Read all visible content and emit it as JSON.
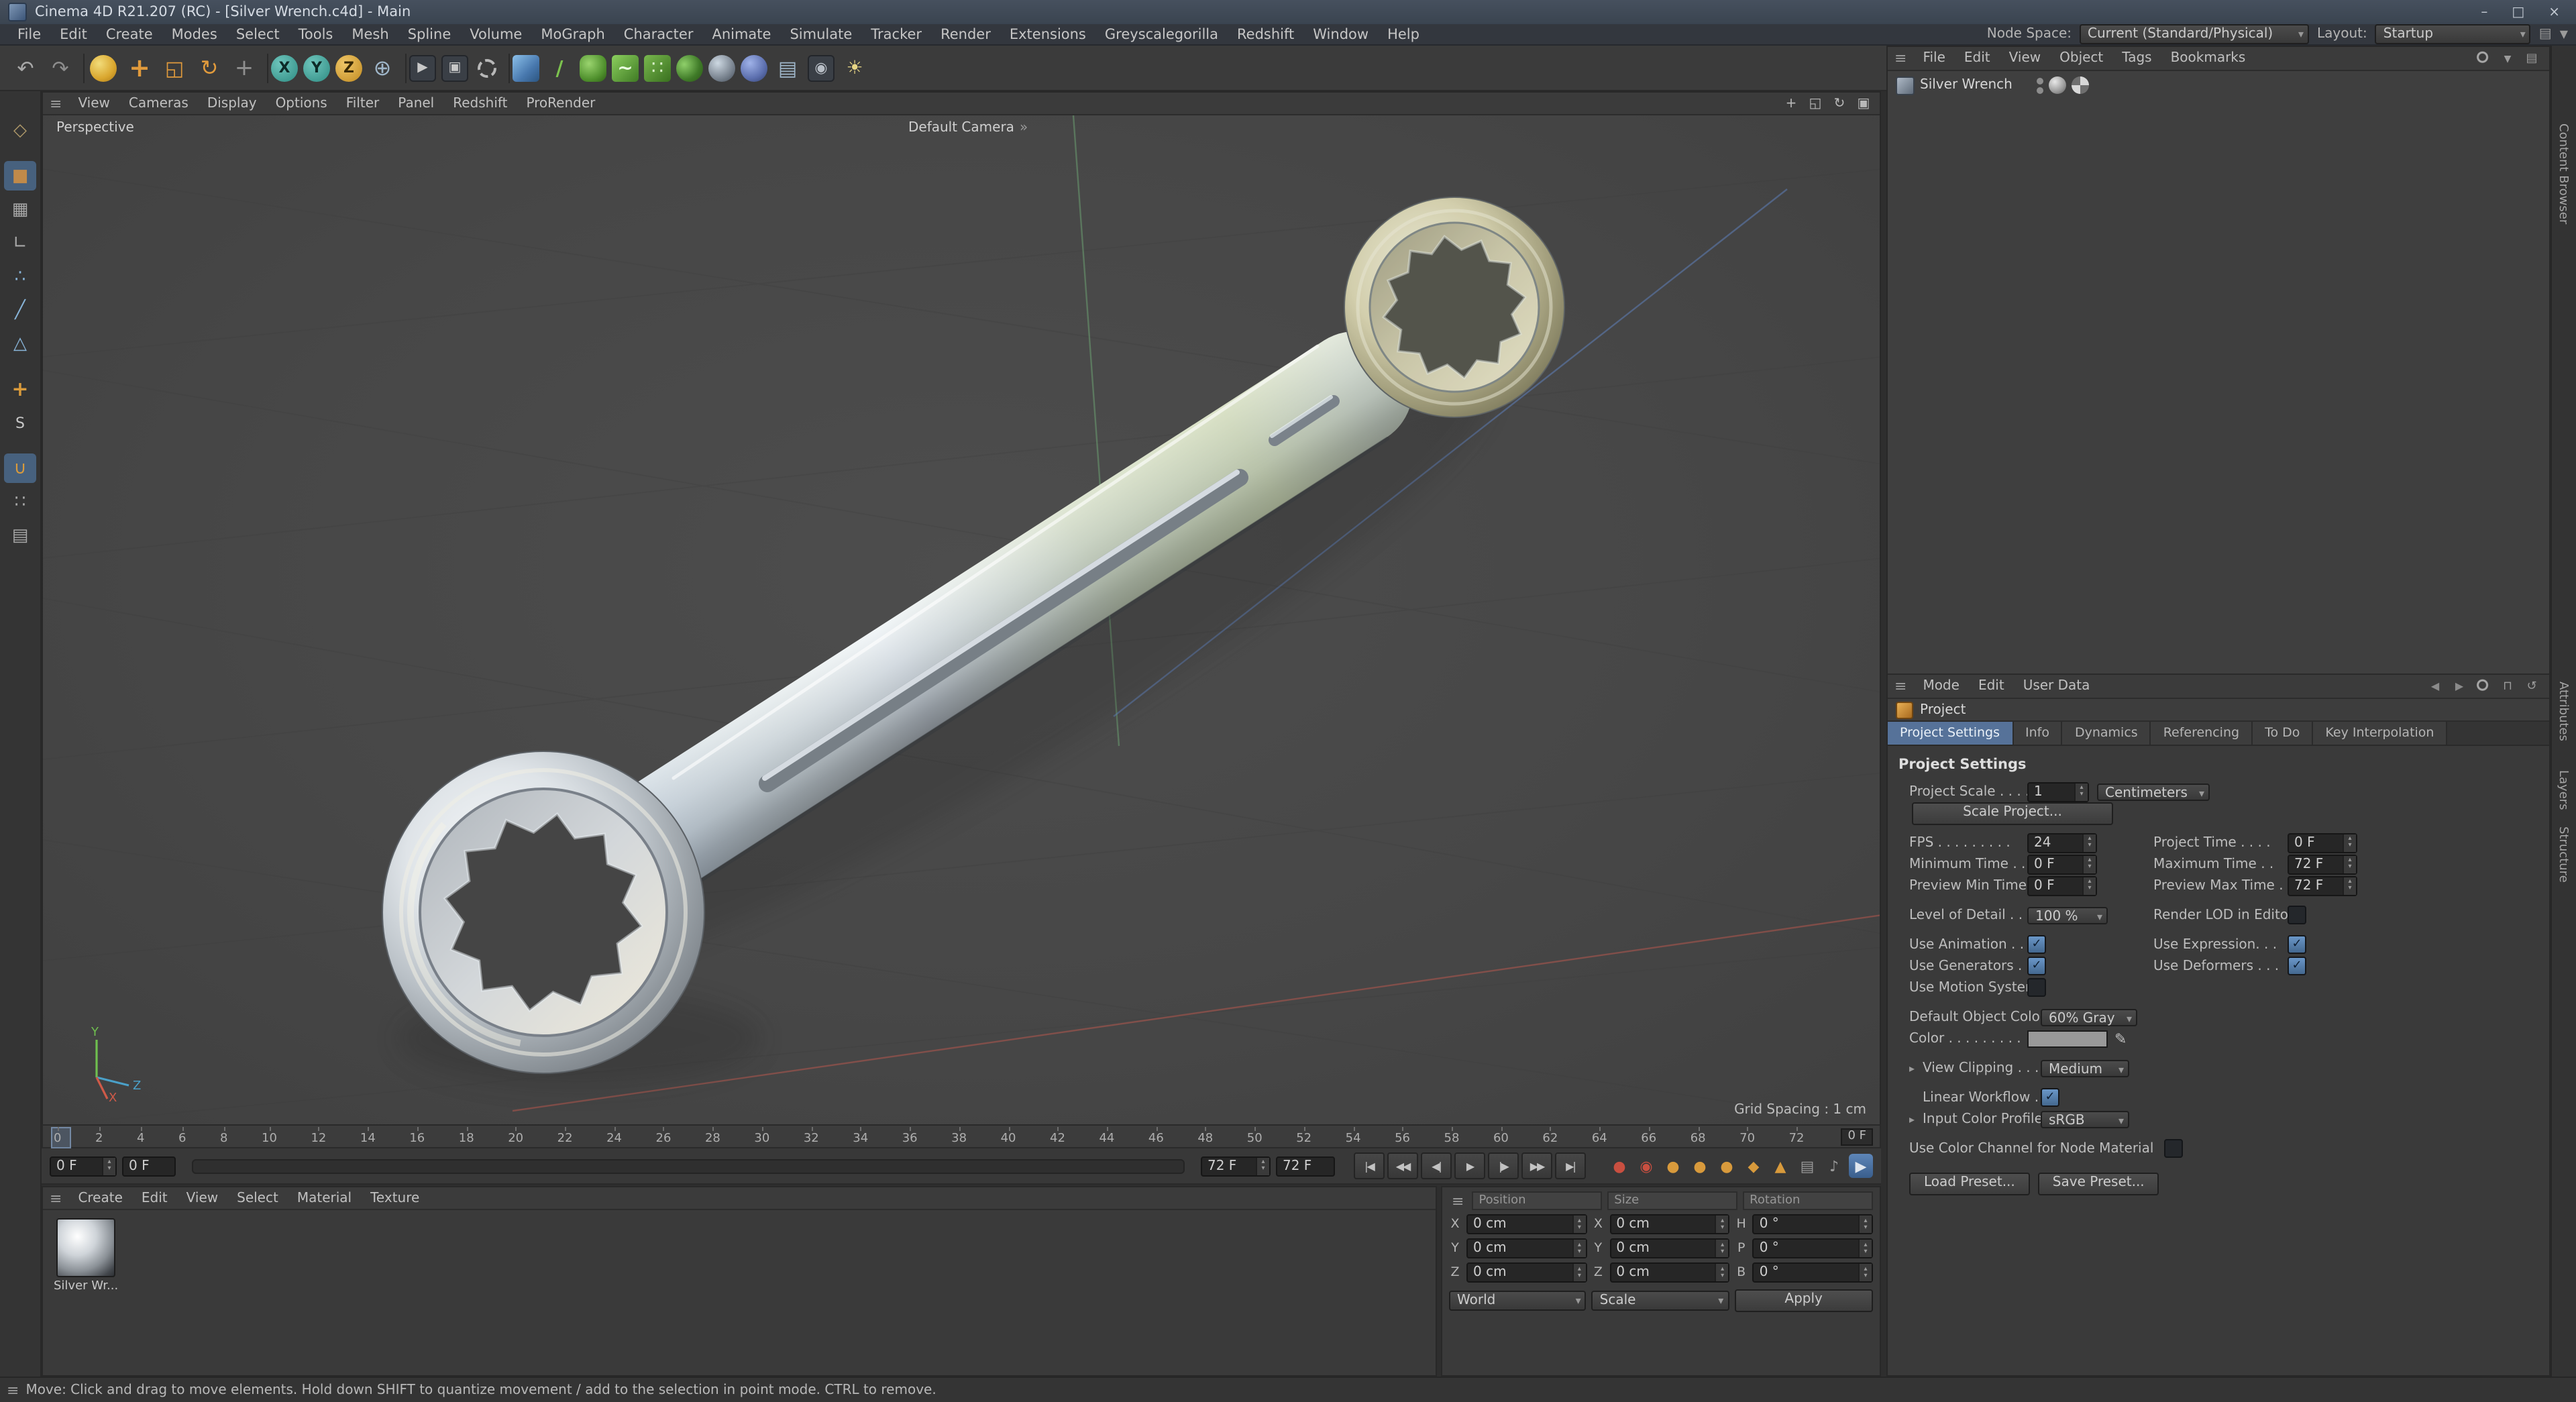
{
  "window": {
    "title": "Cinema 4D R21.207 (RC) - [Silver Wrench.c4d] - Main",
    "minimize": "–",
    "restore": "□",
    "close": "×"
  },
  "menu_bar": {
    "items": [
      "File",
      "Edit",
      "Create",
      "Modes",
      "Select",
      "Tools",
      "Mesh",
      "Spline",
      "Volume",
      "MoGraph",
      "Character",
      "Animate",
      "Simulate",
      "Tracker",
      "Render",
      "Extensions",
      "Greyscalegorilla",
      "Redshift",
      "Window",
      "Help"
    ],
    "node_space_label": "Node Space:",
    "node_space_value": "Current (Standard/Physical)",
    "layout_label": "Layout:",
    "layout_value": "Startup"
  },
  "toolbar": {
    "items": [
      {
        "name": "undo-icon",
        "glyph": "↶",
        "style": "color:#a8a8a8;font-size:15px",
        "inter": "true"
      },
      {
        "name": "redo-icon",
        "glyph": "↷",
        "style": "color:#8d8d8d;font-size:15px",
        "inter": "true"
      },
      {
        "name": "toolbar-separator",
        "glyph": "",
        "style": "width:5px;height:22px;border-right:1px solid #2a2a2a",
        "inter": "false"
      },
      {
        "name": "live-selection-icon",
        "glyph": "",
        "style": "background:radial-gradient(circle at 35% 32%,#f2dc7a,#d9a62e 60%,#a87818);border-radius:50%;width:20px;height:20px;margin:3px 4px",
        "inter": "true"
      },
      {
        "name": "move-tool-icon",
        "glyph": "+",
        "style": "color:#e09a3c;font-size:19px;font-weight:bold",
        "inter": "true"
      },
      {
        "name": "scale-tool-icon",
        "glyph": "◱",
        "style": "color:#e09a3c;font-size:15px",
        "inter": "true"
      },
      {
        "name": "rotate-tool-icon",
        "glyph": "↻",
        "style": "color:#e09a3c;font-size:16px",
        "inter": "true"
      },
      {
        "name": "last-tool-icon",
        "glyph": "+",
        "style": "color:#8f8f8f;font-size:17px",
        "inter": "true"
      },
      {
        "name": "toolbar-separator",
        "glyph": "",
        "style": "width:5px;height:22px;border-right:1px solid #2a2a2a",
        "inter": "false"
      },
      {
        "name": "x-axis-lock-button",
        "glyph": "X",
        "style": "background:radial-gradient(circle at 35% 32%,#6fc6bd,#2e8b82);border-radius:50%;color:#0d2b28;font-weight:bold;width:20px;height:20px;margin:3px 2px;font-size:11px",
        "inter": "true"
      },
      {
        "name": "y-axis-lock-button",
        "glyph": "Y",
        "style": "background:radial-gradient(circle at 35% 32%,#6fc6bd,#2e8b82);border-radius:50%;color:#0d2b28;font-weight:bold;width:20px;height:20px;margin:3px 2px;font-size:11px",
        "inter": "true"
      },
      {
        "name": "z-axis-lock-button",
        "glyph": "Z",
        "style": "background:radial-gradient(circle at 35% 32%,#f0c768,#c08a20);border-radius:50%;color:#3a2a05;font-weight:bold;width:20px;height:20px;margin:3px 2px;font-size:11px",
        "inter": "true"
      },
      {
        "name": "coordinate-system-icon",
        "glyph": "⊕",
        "style": "color:#9fb6c9;font-size:16px",
        "inter": "true"
      },
      {
        "name": "toolbar-separator",
        "glyph": "",
        "style": "width:5px;height:22px;border-right:1px solid #2a2a2a",
        "inter": "false"
      },
      {
        "name": "render-view-icon",
        "glyph": "▶",
        "style": "color:#c8c8c8;background:#3a3f46;border:1px solid #23262b;border-radius:3px;width:20px;height:20px;margin:3px 2px;font-size:10px",
        "inter": "true"
      },
      {
        "name": "render-to-picture-viewer-icon",
        "glyph": "▣",
        "style": "color:#c8c8c8;background:#3a3f46;border:1px solid #23262b;border-radius:3px;width:20px;height:20px;margin:3px 2px;font-size:10px",
        "inter": "true"
      },
      {
        "name": "render-settings-icon",
        "glyph": "",
        "style": "width:14px;height:14px;border:2px dashed #b8b8b8;border-radius:50%;margin:5px 5px",
        "inter": "true"
      },
      {
        "name": "toolbar-separator",
        "glyph": "",
        "style": "width:5px;height:22px;border-right:1px solid #2a2a2a",
        "inter": "false"
      },
      {
        "name": "add-cube-icon",
        "glyph": "",
        "style": "background:linear-gradient(135deg,#8cc1ea,#4878ae 60%,#2c5580);border-radius:3px;width:20px;height:20px;margin:3px 2px",
        "inter": "true"
      },
      {
        "name": "pen-spline-icon",
        "glyph": "/",
        "style": "color:#7cc24e;font-weight:bold;font-size:15px",
        "inter": "true"
      },
      {
        "name": "subdivision-surface-icon",
        "glyph": "",
        "style": "background:radial-gradient(circle at 35% 32%,#9ad46e,#4e8f2c 65%,#2f5c18);border-radius:6px;width:20px;height:20px;margin:3px 2px",
        "inter": "true"
      },
      {
        "name": "bend-deformer-icon",
        "glyph": "~",
        "style": "color:#eaffe0;background:linear-gradient(135deg,#8cd05e,#3f7a24);border-radius:3px;width:20px;height:20px;margin:3px 2px;font-weight:bold",
        "inter": "true"
      },
      {
        "name": "array-generator-icon",
        "glyph": "∷",
        "style": "color:#d8f0c8;background:linear-gradient(135deg,#79b84e,#39701f);border-radius:3px;width:20px;height:20px;margin:3px 2px",
        "inter": "true"
      },
      {
        "name": "boole-icon",
        "glyph": "",
        "style": "background:radial-gradient(circle at 30% 35%,#8fd06a,#3f7a28 60%,#2a5416);border-radius:50%;width:20px;height:20px;margin:3px 2px",
        "inter": "true"
      },
      {
        "name": "metaball-icon",
        "glyph": "",
        "style": "background:radial-gradient(circle at 35% 30%,#cdd8e2,#6c7682 70%,#3e444c);border-radius:50%;width:20px;height:20px;margin:3px 2px",
        "inter": "true"
      },
      {
        "name": "environment-icon",
        "glyph": "",
        "style": "background:radial-gradient(circle at 35% 30%,#9fb2e8,#5c6fae 60%,#32406e);border-radius:50%;width:20px;height:20px;margin:3px 2px",
        "inter": "true"
      },
      {
        "name": "floor-grid-icon",
        "glyph": "▤",
        "style": "color:#9fb6c9;font-size:15px",
        "inter": "true"
      },
      {
        "name": "camera-icon",
        "glyph": "◉",
        "style": "color:#b8bec6;background:#3a3f46;border:1px solid #23262b;border-radius:3px;width:20px;height:20px;margin:3px 2px;font-size:11px",
        "inter": "true"
      },
      {
        "name": "light-icon",
        "glyph": "☀",
        "style": "color:#e8d684;font-size:14px",
        "inter": "true"
      }
    ]
  },
  "left_toolbar": {
    "items": [
      {
        "name": "make-editable-icon",
        "glyph": "◇",
        "style": "color:#b09a6a",
        "inter": "true"
      },
      {
        "name": "left-separator",
        "glyph": "",
        "style": "height:6px",
        "inter": "false"
      },
      {
        "name": "use-model-mode-icon",
        "glyph": "■",
        "style": "color:#c08a4a;background:#47617e;border-radius:3px",
        "inter": "true"
      },
      {
        "name": "use-texture-mode-icon",
        "glyph": "▦",
        "style": "color:#a8a8a8",
        "inter": "true"
      },
      {
        "name": "workplane-mode-icon",
        "glyph": "∟",
        "style": "color:#a8a8a8",
        "inter": "true"
      },
      {
        "name": "points-mode-icon",
        "glyph": "∴",
        "style": "color:#88b4d8",
        "inter": "true"
      },
      {
        "name": "edges-mode-icon",
        "glyph": "╱",
        "style": "color:#88b4d8",
        "inter": "true"
      },
      {
        "name": "polygons-mode-icon",
        "glyph": "△",
        "style": "color:#88b4d8",
        "inter": "true"
      },
      {
        "name": "left-separator",
        "glyph": "",
        "style": "height:6px",
        "inter": "false"
      },
      {
        "name": "enable-axis-icon",
        "glyph": "+",
        "style": "color:#d89a3c;font-weight:bold;font-size:15px",
        "inter": "true"
      },
      {
        "name": "viewport-solo-icon",
        "glyph": "S",
        "style": "color:#c8c8c8;font-size:11px",
        "inter": "true"
      },
      {
        "name": "left-separator",
        "glyph": "",
        "style": "height:6px",
        "inter": "false"
      },
      {
        "name": "snap-enable-icon",
        "glyph": "∪",
        "style": "color:#d89a3c;background:#47617e;border-radius:3px",
        "inter": "true"
      },
      {
        "name": "quantize-icon",
        "glyph": "∷",
        "style": "color:#a8a8a8",
        "inter": "true"
      },
      {
        "name": "workplane-snap-icon",
        "glyph": "▤",
        "style": "color:#a8a8a8",
        "inter": "true"
      }
    ]
  },
  "viewport": {
    "menu_items": [
      "View",
      "Cameras",
      "Display",
      "Options",
      "Filter",
      "Panel",
      "Redshift",
      "ProRender"
    ],
    "icons": [
      {
        "name": "pan-view-icon",
        "glyph": "+"
      },
      {
        "name": "zoom-view-icon",
        "glyph": "◱"
      },
      {
        "name": "rotate-view-icon",
        "glyph": "↻"
      },
      {
        "name": "toggle-view-icon",
        "glyph": "▣"
      }
    ],
    "view_label": "Perspective",
    "camera_label": "Default Camera",
    "camera_menu_glyph": "»",
    "grid_spacing": "Grid Spacing : 1 cm",
    "axis": {
      "x": "X",
      "y": "Y",
      "z": "Z"
    }
  },
  "timeline": {
    "ticks": [
      "0",
      "2",
      "4",
      "6",
      "8",
      "10",
      "12",
      "14",
      "16",
      "18",
      "20",
      "22",
      "24",
      "26",
      "28",
      "30",
      "32",
      "34",
      "36",
      "38",
      "40",
      "42",
      "44",
      "46",
      "48",
      "50",
      "52",
      "54",
      "56",
      "58",
      "60",
      "62",
      "64",
      "66",
      "68",
      "70",
      "72"
    ],
    "end_field": "0 F"
  },
  "transport": {
    "current_frame": "0 F",
    "frame_alt": "0 F",
    "range_end": "72 F",
    "range_end_alt": "72 F",
    "buttons": [
      {
        "name": "goto-start-button",
        "glyph": "|◀"
      },
      {
        "name": "prev-key-button",
        "glyph": "◀◀"
      },
      {
        "name": "prev-frame-button",
        "glyph": "◀|"
      },
      {
        "name": "play-button",
        "glyph": "▶"
      },
      {
        "name": "next-frame-button",
        "glyph": "|▶"
      },
      {
        "name": "next-key-button",
        "glyph": "▶▶"
      },
      {
        "name": "goto-end-button",
        "glyph": "▶|"
      }
    ],
    "icons": [
      {
        "name": "record-keyframe-icon",
        "glyph": "●",
        "style": "color:#c94f40"
      },
      {
        "name": "autokeying-icon",
        "glyph": "◉",
        "style": "color:#c94f40"
      },
      {
        "name": "key-position-icon",
        "glyph": "●",
        "style": "color:#d89a3c"
      },
      {
        "name": "key-scale-icon",
        "glyph": "●",
        "style": "color:#d89a3c"
      },
      {
        "name": "key-rotation-icon",
        "glyph": "●",
        "style": "color:#d89a3c"
      },
      {
        "name": "key-parameter-icon",
        "glyph": "◆",
        "style": "color:#d89a3c"
      },
      {
        "name": "key-pla-icon",
        "glyph": "▲",
        "style": "color:#d89a3c"
      },
      {
        "name": "playback-settings-icon",
        "glyph": "▤",
        "style": "color:#9a9a9a"
      },
      {
        "name": "sound-icon",
        "glyph": "♪",
        "style": "color:#9a9a9a"
      },
      {
        "name": "make-preview-icon",
        "glyph": "▶",
        "style": "color:#dfe6ee;background:linear-gradient(180deg,#5e86b8,#3a5e8c);border-radius:3px"
      }
    ]
  },
  "materials": {
    "menu_items": [
      "Create",
      "Edit",
      "View",
      "Select",
      "Material",
      "Texture"
    ],
    "items": [
      {
        "name": "Silver Wr..."
      }
    ]
  },
  "coordinates": {
    "headers": [
      "Position",
      "Size",
      "Rotation"
    ],
    "rows": [
      {
        "c1l": "X",
        "c1v": "0 cm",
        "c2l": "X",
        "c2v": "0 cm",
        "c3l": "H",
        "c3v": "0 °"
      },
      {
        "c1l": "Y",
        "c1v": "0 cm",
        "c2l": "Y",
        "c2v": "0 cm",
        "c3l": "P",
        "c3v": "0 °"
      },
      {
        "c1l": "Z",
        "c1v": "0 cm",
        "c2l": "Z",
        "c2v": "0 cm",
        "c3l": "B",
        "c3v": "0 °"
      }
    ],
    "space": "World",
    "mode": "Scale",
    "apply": "Apply"
  },
  "object_manager": {
    "menu_items": [
      "File",
      "Edit",
      "View",
      "Object",
      "Tags",
      "Bookmarks"
    ],
    "icons": [
      {
        "name": "om-search-icon",
        "glyph": "",
        "style": "background:radial-gradient(circle at 45% 40%,rgba(0,0,0,0) 2.5px,#a8a8a8 3px 4px,rgba(0,0,0,0) 4.5px)"
      },
      {
        "name": "om-filter-icon",
        "glyph": "▼",
        "style": "color:#9a9a9a;font-size:7px"
      },
      {
        "name": "om-view-icon",
        "glyph": "▤",
        "style": "color:#9a9a9a"
      }
    ],
    "objects": [
      {
        "name": "Silver Wrench"
      }
    ]
  },
  "attribute_manager": {
    "menu_items": [
      "Mode",
      "Edit",
      "User Data"
    ],
    "icons": [
      {
        "name": "am-back-icon",
        "glyph": "◀",
        "style": "color:#8a8a8a;font-size:8px"
      },
      {
        "name": "am-forward-icon",
        "glyph": "▶",
        "style": "color:#8a8a8a;font-size:8px"
      },
      {
        "name": "am-search-icon",
        "glyph": "",
        "style": "background:radial-gradient(circle at 45% 40%,rgba(0,0,0,0) 2.5px,#a8a8a8 3px 4px,rgba(0,0,0,0) 4.5px)"
      },
      {
        "name": "am-lock-icon",
        "glyph": "⊓",
        "style": "color:#9a9a9a"
      },
      {
        "name": "am-history-icon",
        "glyph": "↺",
        "style": "color:#9a9a9a"
      }
    ],
    "object_title": "Project",
    "tabs": [
      {
        "label": "Project Settings",
        "active": "true"
      },
      {
        "label": "Info",
        "active": "false"
      },
      {
        "label": "Dynamics",
        "active": "false"
      },
      {
        "label": "Referencing",
        "active": "false"
      },
      {
        "label": "To Do",
        "active": "false"
      },
      {
        "label": "Key Interpolation",
        "active": "false"
      }
    ],
    "section_title": "Project Settings",
    "project_scale": {
      "label": "Project Scale . . . .",
      "value": "1",
      "unit": "Centimeters"
    },
    "scale_project_button": "Scale Project...",
    "fps": {
      "label": "FPS . . . . . . . . .",
      "value": "24"
    },
    "project_time": {
      "label": "Project Time . . . .",
      "value": "0 F"
    },
    "minimum_time": {
      "label": "Minimum Time . .",
      "value": "0 F"
    },
    "maximum_time": {
      "label": "Maximum Time . .",
      "value": "72 F"
    },
    "preview_min_time": {
      "label": "Preview Min Time .",
      "value": "0 F"
    },
    "preview_max_time": {
      "label": "Preview Max Time .",
      "value": "72 F"
    },
    "level_of_detail": {
      "label": "Level of Detail . . .",
      "value": "100 %"
    },
    "render_lod": {
      "label": "Render LOD in Editor",
      "checked": false
    },
    "use_animation": {
      "label": "Use Animation . . .",
      "checked": true
    },
    "use_expression": {
      "label": "Use Expression. . .",
      "checked": true
    },
    "use_generators": {
      "label": "Use Generators . . .",
      "checked": true
    },
    "use_deformers": {
      "label": "Use Deformers . . .",
      "checked": true
    },
    "use_motion_system": {
      "label": "Use Motion System",
      "checked": false
    },
    "default_object_color": {
      "label": "Default Object Color",
      "value": "60% Gray"
    },
    "color": {
      "label": "Color . . . . . . . . .",
      "swatch": "#999999"
    },
    "view_clipping": {
      "label": "View Clipping . . . .",
      "value": "Medium"
    },
    "linear_workflow": {
      "label": "Linear Workflow . .",
      "checked": true
    },
    "input_color_profile": {
      "label": "Input Color Profile .",
      "value": "sRGB"
    },
    "use_color_channel": {
      "label": "Use Color Channel for Node Material",
      "checked": false
    },
    "load_preset_button": "Load Preset...",
    "save_preset_button": "Save Preset..."
  },
  "right_edge_tabs": [
    "Content Browser",
    "Attributes",
    "Layers",
    "Structure"
  ],
  "status_bar": {
    "text": "Move: Click and drag to move elements. Hold down SHIFT to quantize movement / add to the selection in point mode. CTRL to remove."
  }
}
